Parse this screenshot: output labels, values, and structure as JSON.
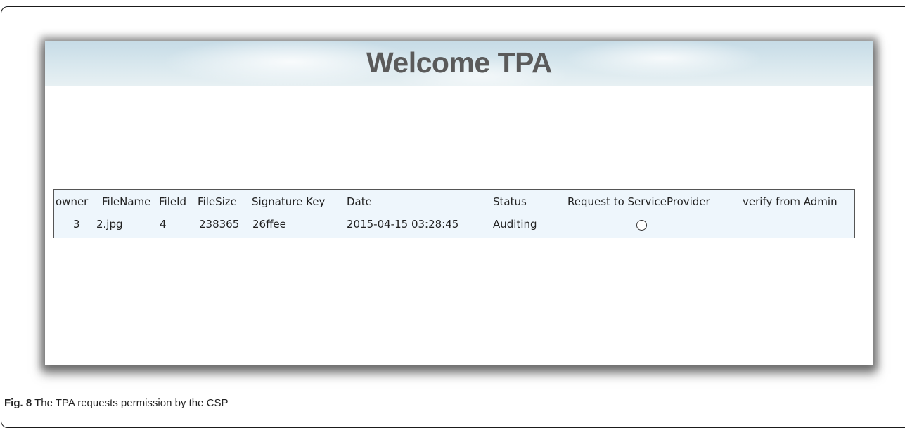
{
  "banner": {
    "title": "Welcome TPA"
  },
  "table": {
    "headers": [
      "owner",
      "FileName",
      "FileId",
      "FileSize",
      "Signature Key",
      "Date",
      "Status",
      "Request to ServiceProvider",
      "verify from Admin"
    ],
    "rows": [
      {
        "owner": "3",
        "filename": "2.jpg",
        "fileid": "4",
        "filesize": "238365",
        "signature_key": "26ffee",
        "date": "2015-04-15 03:28:45",
        "status": "Auditing",
        "request_selected": false,
        "verify": ""
      }
    ]
  },
  "caption": {
    "label": "Fig. 8",
    "text": " The TPA requests permission by the CSP"
  }
}
